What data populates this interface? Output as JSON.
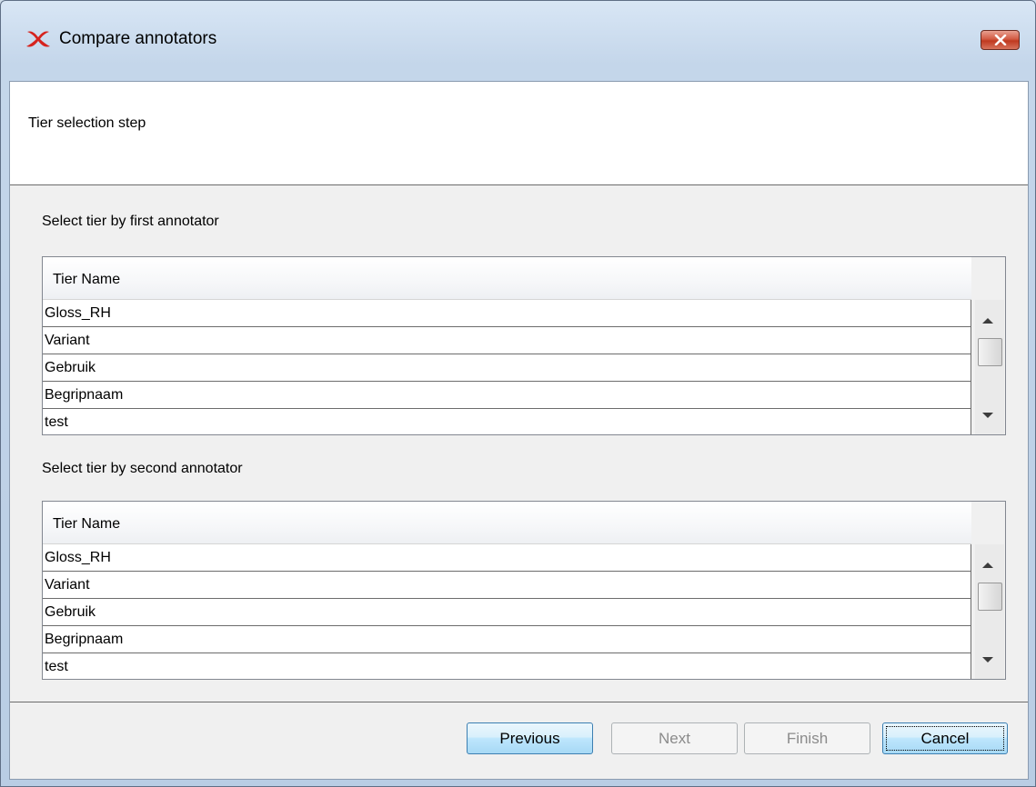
{
  "window": {
    "title": "Compare annotators",
    "close_icon": "close-icon",
    "app_icon": "elan-app-icon"
  },
  "header": {
    "step_title": "Tier selection step"
  },
  "first": {
    "label": "Select tier by first annotator",
    "column": "Tier Name",
    "rows": [
      "Gloss_RH",
      "Variant",
      "Gebruik",
      "Begripnaam",
      "test"
    ]
  },
  "second": {
    "label": "Select tier by second annotator",
    "column": "Tier Name",
    "rows": [
      "Gloss_RH",
      "Variant",
      "Gebruik",
      "Begripnaam",
      "test"
    ]
  },
  "buttons": {
    "previous": "Previous",
    "next": "Next",
    "finish": "Finish",
    "cancel": "Cancel"
  },
  "colors": {
    "accent": "#3c7fb1",
    "close": "#c0391f"
  }
}
